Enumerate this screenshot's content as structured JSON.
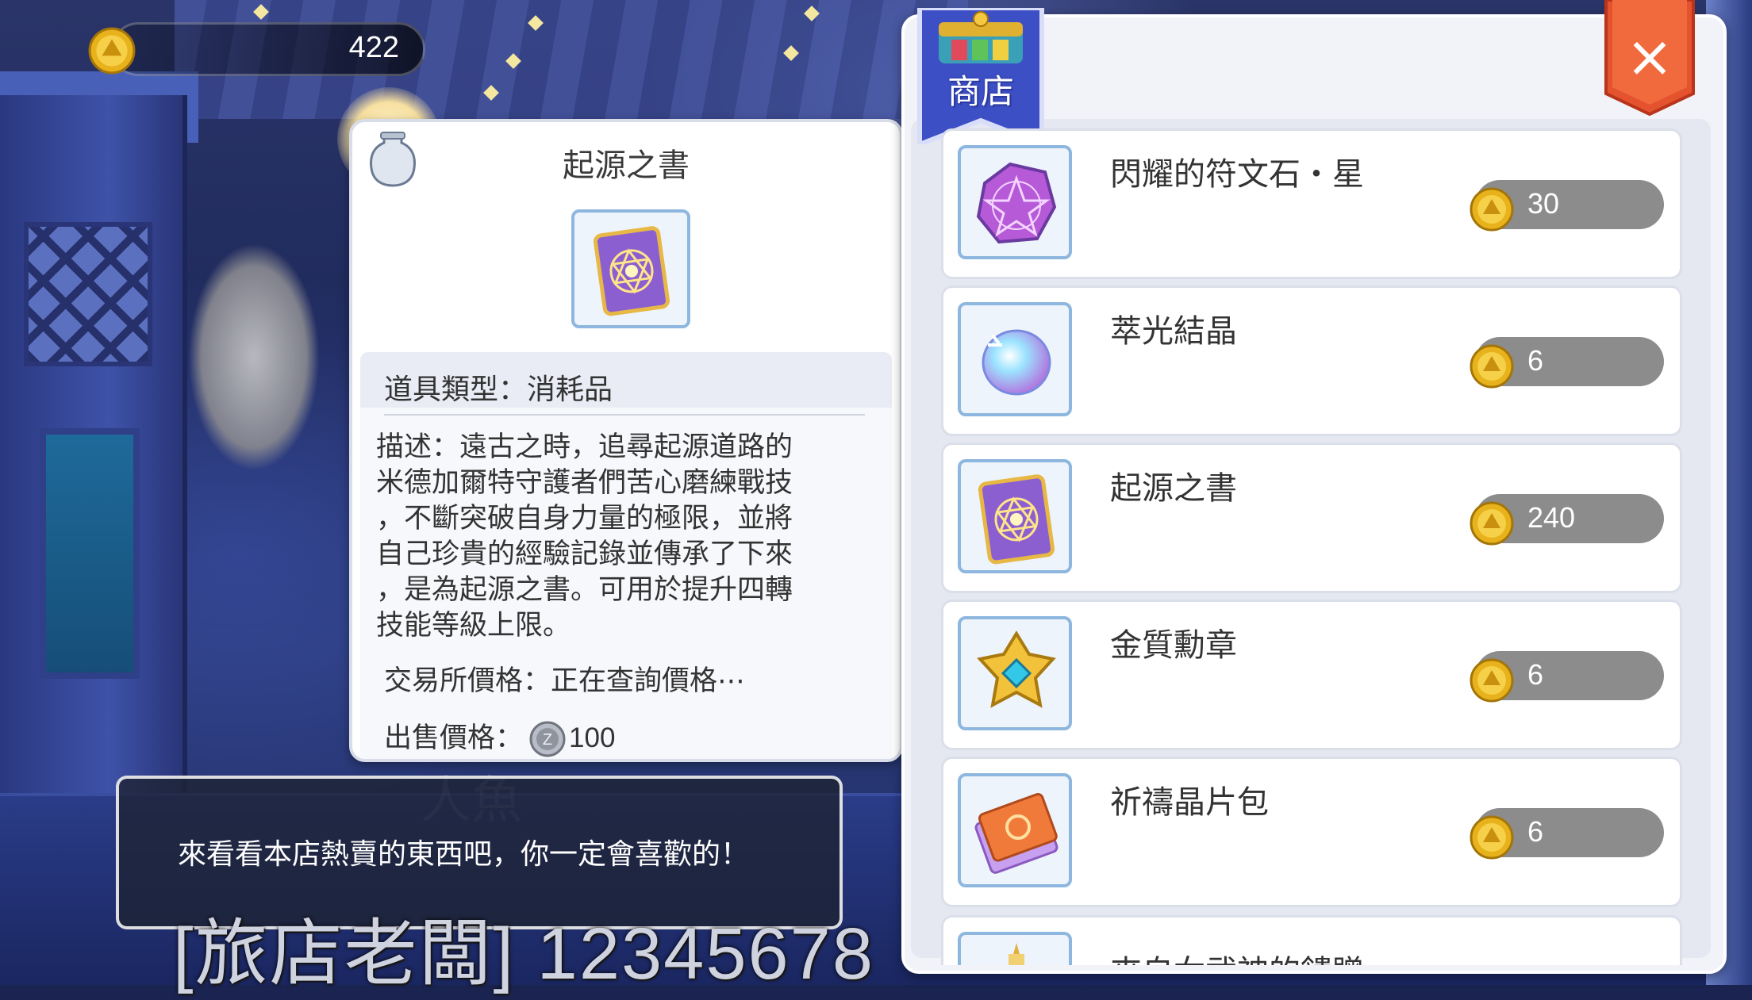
{
  "currency": {
    "value": "422",
    "icon": "gold-coin-icon"
  },
  "detail": {
    "title": "起源之書",
    "icon": "origin-book-icon",
    "type_line": "道具類型：消耗品",
    "description_lines": [
      "描述：遠古之時，追尋起源道路的",
      "米德加爾特守護者們苦心磨練戰技",
      "，不斷突破自身力量的極限，並將",
      "自己珍貴的經驗記錄並傳承了下來",
      "，是為起源之書。可用於提升四轉",
      "技能等級上限。"
    ],
    "exchange_line": "交易所價格：正在查詢價格⋯",
    "sell_label": "出售價格：",
    "sell_value": "100",
    "sell_icon": "zeny-coin-icon"
  },
  "dialog": {
    "text": "來看看本店熱賣的東西吧，你一定會喜歡的！",
    "ghost_text": "人魚",
    "npc_name": "[旅店老闆] 12345678"
  },
  "shop": {
    "title": "商店",
    "close_label": "×",
    "items": [
      {
        "name": "閃耀的符文石・星",
        "price": "30",
        "icon": "rune-stone-icon"
      },
      {
        "name": "萃光結晶",
        "price": "6",
        "icon": "crystal-icon"
      },
      {
        "name": "起源之書",
        "price": "240",
        "icon": "origin-book-icon"
      },
      {
        "name": "金質勳章",
        "price": "6",
        "icon": "gold-medal-icon"
      },
      {
        "name": "祈禱晶片包",
        "price": "6",
        "icon": "card-pack-icon"
      }
    ],
    "partial_item": {
      "name": "來自女武神的饋贈",
      "icon": "valkyrie-gift-icon"
    }
  },
  "colors": {
    "panel_border": "#8db7de",
    "price_pill": "#8c8c8c",
    "close_red": "#e5532e",
    "banner_blue": "#3d4fc4"
  }
}
